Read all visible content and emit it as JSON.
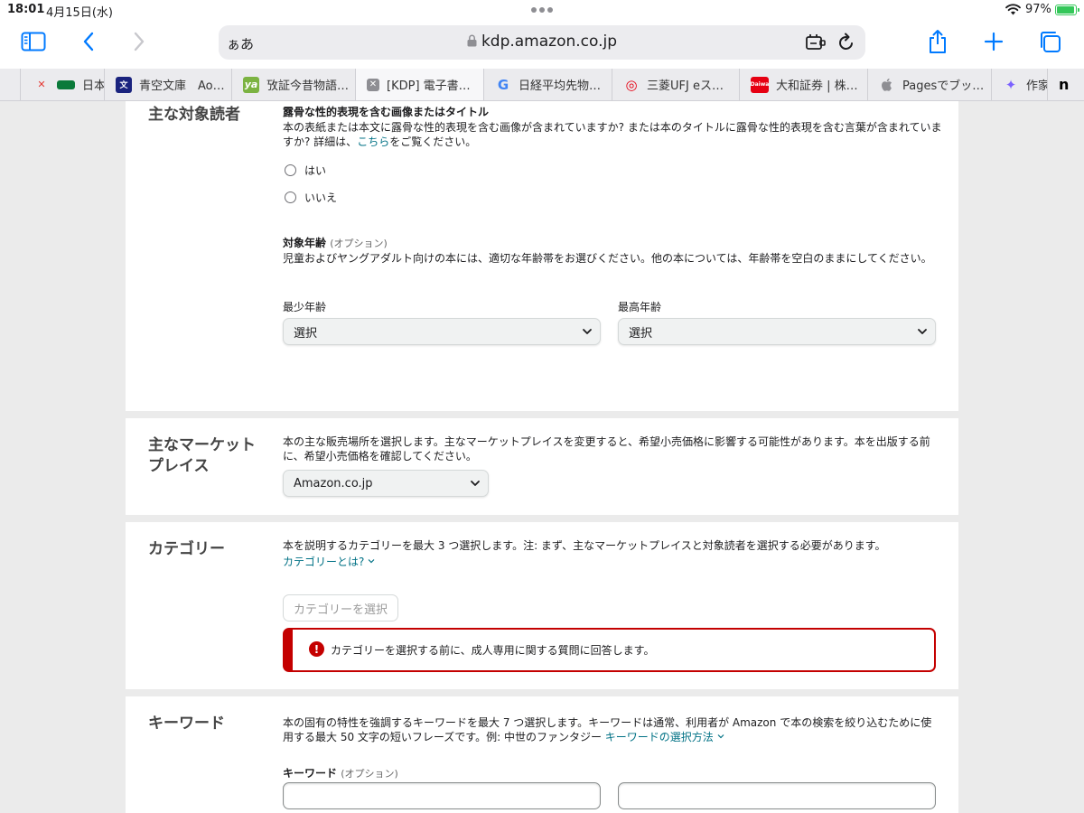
{
  "status": {
    "time": "18:01",
    "date": "4月15日(水)",
    "battery": "97%"
  },
  "browser": {
    "address_prefix": "ぁあ",
    "url": "kdp.amazon.co.jp",
    "tabs": [
      {
        "title": "日本",
        "fav": "",
        "fav_color": "#0a7a3a"
      },
      {
        "title": "青空文庫　Ao…",
        "fav": "文",
        "fav_color": "#1a237e"
      },
      {
        "title": "攷証今昔物語…",
        "fav": "ya",
        "fav_color": "#7cb342"
      },
      {
        "title": "[KDP] 電子書…",
        "fav": "✕",
        "fav_color": "#8e8e93"
      },
      {
        "title": "日経平均先物…",
        "fav": "G",
        "fav_color": "#4285f4"
      },
      {
        "title": "三菱UFJ eス…",
        "fav": "◎",
        "fav_color": "#e60012"
      },
      {
        "title": "大和証券 | 株…",
        "fav": "Daiwa",
        "fav_color": "#e60012"
      },
      {
        "title": "Pagesでブッ…",
        "fav": "",
        "fav_color": "#8e8e93"
      },
      {
        "title": "作家",
        "fav": "✦",
        "fav_color": "#7b61ff"
      },
      {
        "title": "n",
        "fav": "",
        "fav_color": "#000000"
      }
    ]
  },
  "audience": {
    "section_title": "主な対象読者",
    "explicit_heading": "露骨な性的表現を含む画像またはタイトル",
    "explicit_desc": "本の表紙または本文に露骨な性的表現を含む画像が含まれていますか? または本のタイトルに露骨な性的表現を含む言葉が含まれていますか? 詳細は、",
    "explicit_link": "こちら",
    "explicit_desc_end": "をご覧ください。",
    "yes": "はい",
    "no": "いいえ",
    "age_label": "対象年齢",
    "age_optional": "(オプション)",
    "age_desc": "児童およびヤングアダルト向けの本には、適切な年齢帯をお選びください。他の本については、年齢帯を空白のままにしてください。",
    "min_age_label": "最少年齢",
    "max_age_label": "最高年齢",
    "min_age_value": "選択",
    "max_age_value": "選択"
  },
  "marketplace": {
    "section_title": "主なマーケットプレイス",
    "desc": "本の主な販売場所を選択します。主なマーケットプレイスを変更すると、希望小売価格に影響する可能性があります。本を出版する前に、希望小売価格を確認してください。",
    "value": "Amazon.co.jp"
  },
  "category": {
    "section_title": "カテゴリー",
    "desc": "本を説明するカテゴリーを最大 3 つ選択します。注: まず、主なマーケットプレイスと対象読者を選択する必要があります。",
    "help_link": "カテゴリーとは?",
    "button": "カテゴリーを選択",
    "alert": "カテゴリーを選択する前に、成人専用に関する質問に回答します。"
  },
  "keywords": {
    "section_title": "キーワード",
    "desc": "本の固有の特性を強調するキーワードを最大 7 つ選択します。キーワードは通常、利用者が Amazon で本の検索を絞り込むために使用する最大 50 文字の短いフレーズです。例: 中世のファンタジー",
    "help_link": "キーワードの選択方法",
    "label": "キーワード",
    "optional": "(オプション)"
  }
}
